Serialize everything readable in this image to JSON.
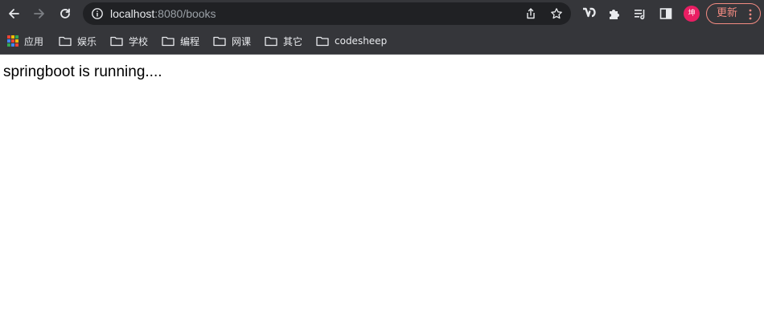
{
  "browser": {
    "url_host": "localhost",
    "url_rest": ":8080/books",
    "avatar_text": "坤",
    "update_label": "更新"
  },
  "bookmarks": {
    "apps_label": "应用",
    "items": [
      {
        "label": "娱乐"
      },
      {
        "label": "学校"
      },
      {
        "label": "编程"
      },
      {
        "label": "网课"
      },
      {
        "label": "其它"
      },
      {
        "label": "codesheep"
      }
    ]
  },
  "page": {
    "body_text": "springboot is running...."
  },
  "colors": {
    "chrome_bg": "#35363a",
    "omnibox_bg": "#202124",
    "avatar_bg": "#e91e63",
    "update_accent": "#f28b82"
  }
}
